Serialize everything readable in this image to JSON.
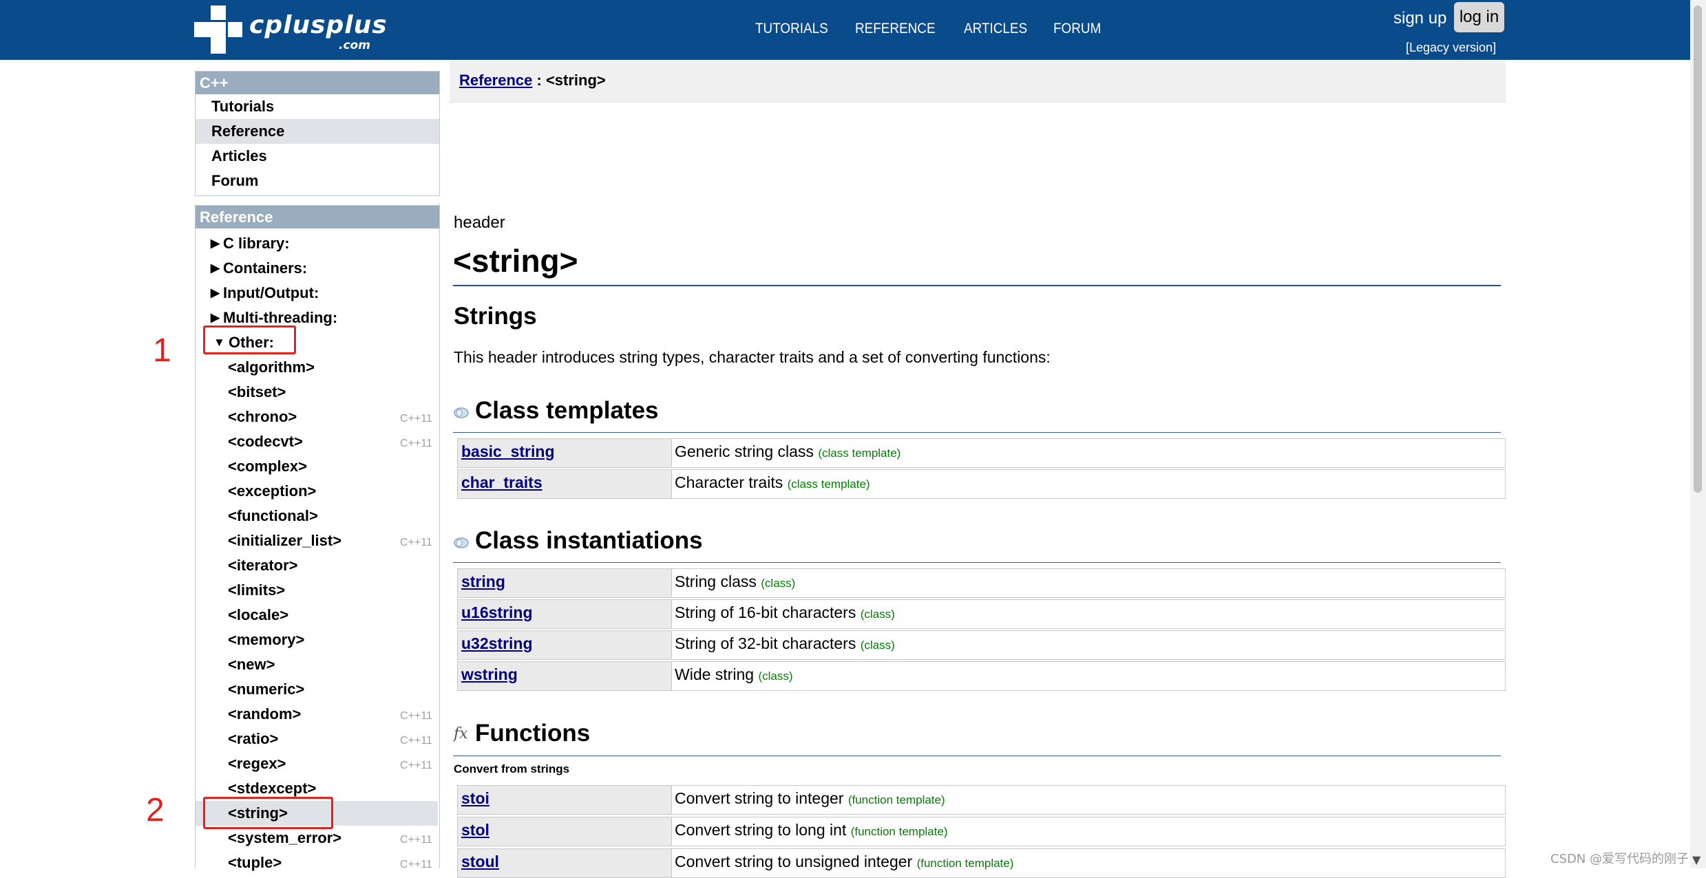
{
  "header": {
    "logo_text": "cplusplus",
    "logo_sub": ".com",
    "nav": [
      "TUTORIALS",
      "REFERENCE",
      "ARTICLES",
      "FORUM"
    ],
    "sign_up": "sign up",
    "log_in": "log in",
    "legacy": "[Legacy version]"
  },
  "sidebar": {
    "cpp_title": "C++",
    "cpp_items": [
      "Tutorials",
      "Reference",
      "Articles",
      "Forum"
    ],
    "ref_title": "Reference",
    "ref_items": [
      "C library:",
      "Containers:",
      "Input/Output:",
      "Multi-threading:",
      "Other:"
    ],
    "other_items": [
      {
        "label": "<algorithm>",
        "tag": ""
      },
      {
        "label": "<bitset>",
        "tag": ""
      },
      {
        "label": "<chrono>",
        "tag": "C++11"
      },
      {
        "label": "<codecvt>",
        "tag": "C++11"
      },
      {
        "label": "<complex>",
        "tag": ""
      },
      {
        "label": "<exception>",
        "tag": ""
      },
      {
        "label": "<functional>",
        "tag": ""
      },
      {
        "label": "<initializer_list>",
        "tag": "C++11"
      },
      {
        "label": "<iterator>",
        "tag": ""
      },
      {
        "label": "<limits>",
        "tag": ""
      },
      {
        "label": "<locale>",
        "tag": ""
      },
      {
        "label": "<memory>",
        "tag": ""
      },
      {
        "label": "<new>",
        "tag": ""
      },
      {
        "label": "<numeric>",
        "tag": ""
      },
      {
        "label": "<random>",
        "tag": "C++11"
      },
      {
        "label": "<ratio>",
        "tag": "C++11"
      },
      {
        "label": "<regex>",
        "tag": "C++11"
      },
      {
        "label": "<stdexcept>",
        "tag": ""
      },
      {
        "label": "<string>",
        "tag": ""
      },
      {
        "label": "<system_error>",
        "tag": "C++11"
      },
      {
        "label": "<tuple>",
        "tag": "C++11"
      }
    ]
  },
  "annotations": {
    "marker1": "1",
    "marker2": "2"
  },
  "main": {
    "breadcrumb_link": "Reference",
    "breadcrumb_sep": " : ",
    "breadcrumb_current": "<string>",
    "header_label": "header",
    "title": "<string>",
    "strings_heading": "Strings",
    "intro": "This header introduces string types, character traits and a set of converting functions:",
    "class_templates": {
      "title": "Class templates",
      "rows": [
        {
          "name": "basic_string",
          "desc": "Generic string class",
          "kind": "(class template)"
        },
        {
          "name": "char_traits",
          "desc": "Character traits",
          "kind": "(class template)"
        }
      ]
    },
    "class_instantiations": {
      "title": "Class instantiations",
      "rows": [
        {
          "name": "string",
          "desc": "String class",
          "kind": "(class)"
        },
        {
          "name": "u16string",
          "desc": "String of 16-bit characters",
          "kind": "(class)"
        },
        {
          "name": "u32string",
          "desc": "String of 32-bit characters",
          "kind": "(class)"
        },
        {
          "name": "wstring",
          "desc": "Wide string",
          "kind": "(class)"
        }
      ]
    },
    "functions": {
      "icon_text": "fx",
      "title": "Functions",
      "subcaption": "Convert from strings",
      "rows": [
        {
          "name": "stoi",
          "desc": "Convert string to integer",
          "kind": "(function template)"
        },
        {
          "name": "stol",
          "desc": "Convert string to long int",
          "kind": "(function template)"
        },
        {
          "name": "stoul",
          "desc": "Convert string to unsigned integer",
          "kind": "(function template)"
        }
      ]
    }
  },
  "watermark": "CSDN @爱写代码的刚子"
}
